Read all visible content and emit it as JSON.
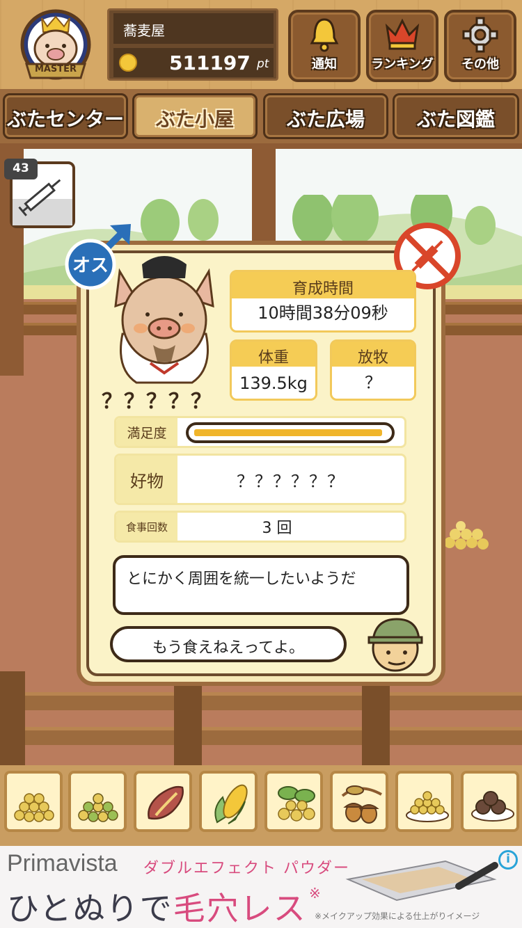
{
  "user": {
    "name": "蕎麦屋",
    "points": "511197",
    "points_unit": "pt",
    "badge_label": "MASTER"
  },
  "header_buttons": [
    {
      "label": "通知",
      "icon": "bell-icon"
    },
    {
      "label": "ランキング",
      "icon": "crown-icon"
    },
    {
      "label": "その他",
      "icon": "gear-icon"
    }
  ],
  "nav_tabs": [
    {
      "label": "ぶたセンター",
      "active": false
    },
    {
      "label": "ぶた小屋",
      "active": true
    },
    {
      "label": "ぶた広場",
      "active": false
    },
    {
      "label": "ぶた図鑑",
      "active": false
    }
  ],
  "item": {
    "count": "43",
    "icon": "syringe-icon"
  },
  "pig": {
    "gender_label": "オス",
    "name": "？？？？？",
    "stats": {
      "growth_time_label": "育成時間",
      "growth_time_value": "10時間38分09秒",
      "weight_label": "体重",
      "weight_value": "139.5kg",
      "grazing_label": "放牧",
      "grazing_value": "？"
    },
    "satisfaction_label": "満足度",
    "satisfaction_level": 0.98,
    "favorite_label": "好物",
    "favorite_value": "？？？？？？",
    "meals_label": "食事回数",
    "meals_value": "3 回",
    "comment": "とにかく周囲を統一したいようだ",
    "farmer_comment": "もう食えねえってよ。"
  },
  "foods": [
    "soybean-pile-icon",
    "mixed-beans-icon",
    "sweet-potato-icon",
    "corn-icon",
    "leaf-beans-icon",
    "acorn-icon",
    "grain-plate-icon",
    "meatball-plate-icon"
  ],
  "colors": {
    "accent_yellow": "#f5cc55",
    "wood_dark": "#5c3a1d",
    "male_blue": "#2a6fb8",
    "ban_red": "#d9462a"
  },
  "ad": {
    "brand": "Primavista",
    "tagline": "ダブルエフェクト パウダー",
    "headline_a": "ひとぬりで",
    "headline_b": "毛穴レス",
    "star": "※",
    "note": "※メイクアップ効果による仕上がりイメージ",
    "info": "i"
  }
}
